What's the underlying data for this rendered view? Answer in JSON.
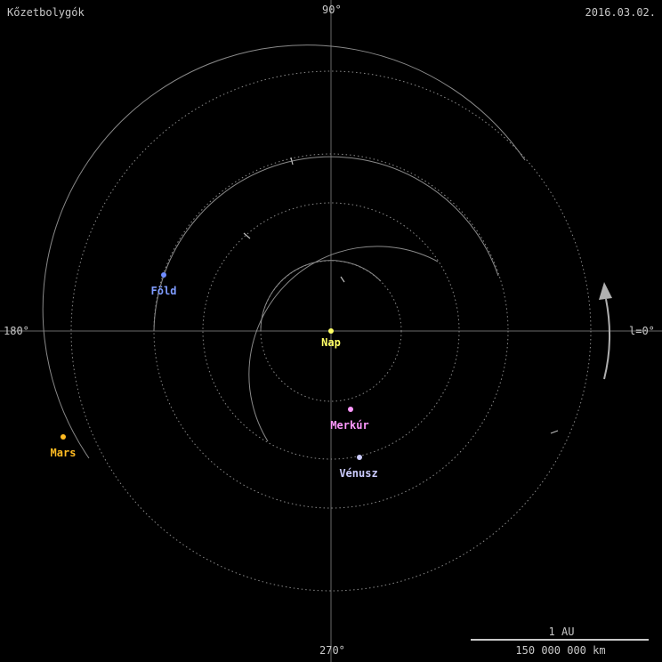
{
  "header": {
    "title": "Kőzetbolygók",
    "date": "2016.03.02."
  },
  "angles": {
    "deg90": "90°",
    "deg180": "180°",
    "deg0": "l=0°",
    "deg270": "270°"
  },
  "bodies": [
    {
      "name": "Nap",
      "color": "#ffff66",
      "label_color": "#ffff66"
    },
    {
      "name": "Merkúr",
      "color": "#ff99ff",
      "label_color": "#ff99ff"
    },
    {
      "name": "Vénusz",
      "color": "#ccccff",
      "label_color": "#ccccff"
    },
    {
      "name": "Föld",
      "color": "#6f8cff",
      "label_color": "#7f9cff"
    },
    {
      "name": "Mars",
      "color": "#ffbb22",
      "label_color": "#ffbb22"
    }
  ],
  "scale": {
    "top_label": "1 AU",
    "bottom_label": "150 000 000 km"
  },
  "colors": {
    "background": "#000000",
    "orbit": "#8a8a8a",
    "axis": "#6a6a6a",
    "arrow": "#b0b0b0"
  }
}
